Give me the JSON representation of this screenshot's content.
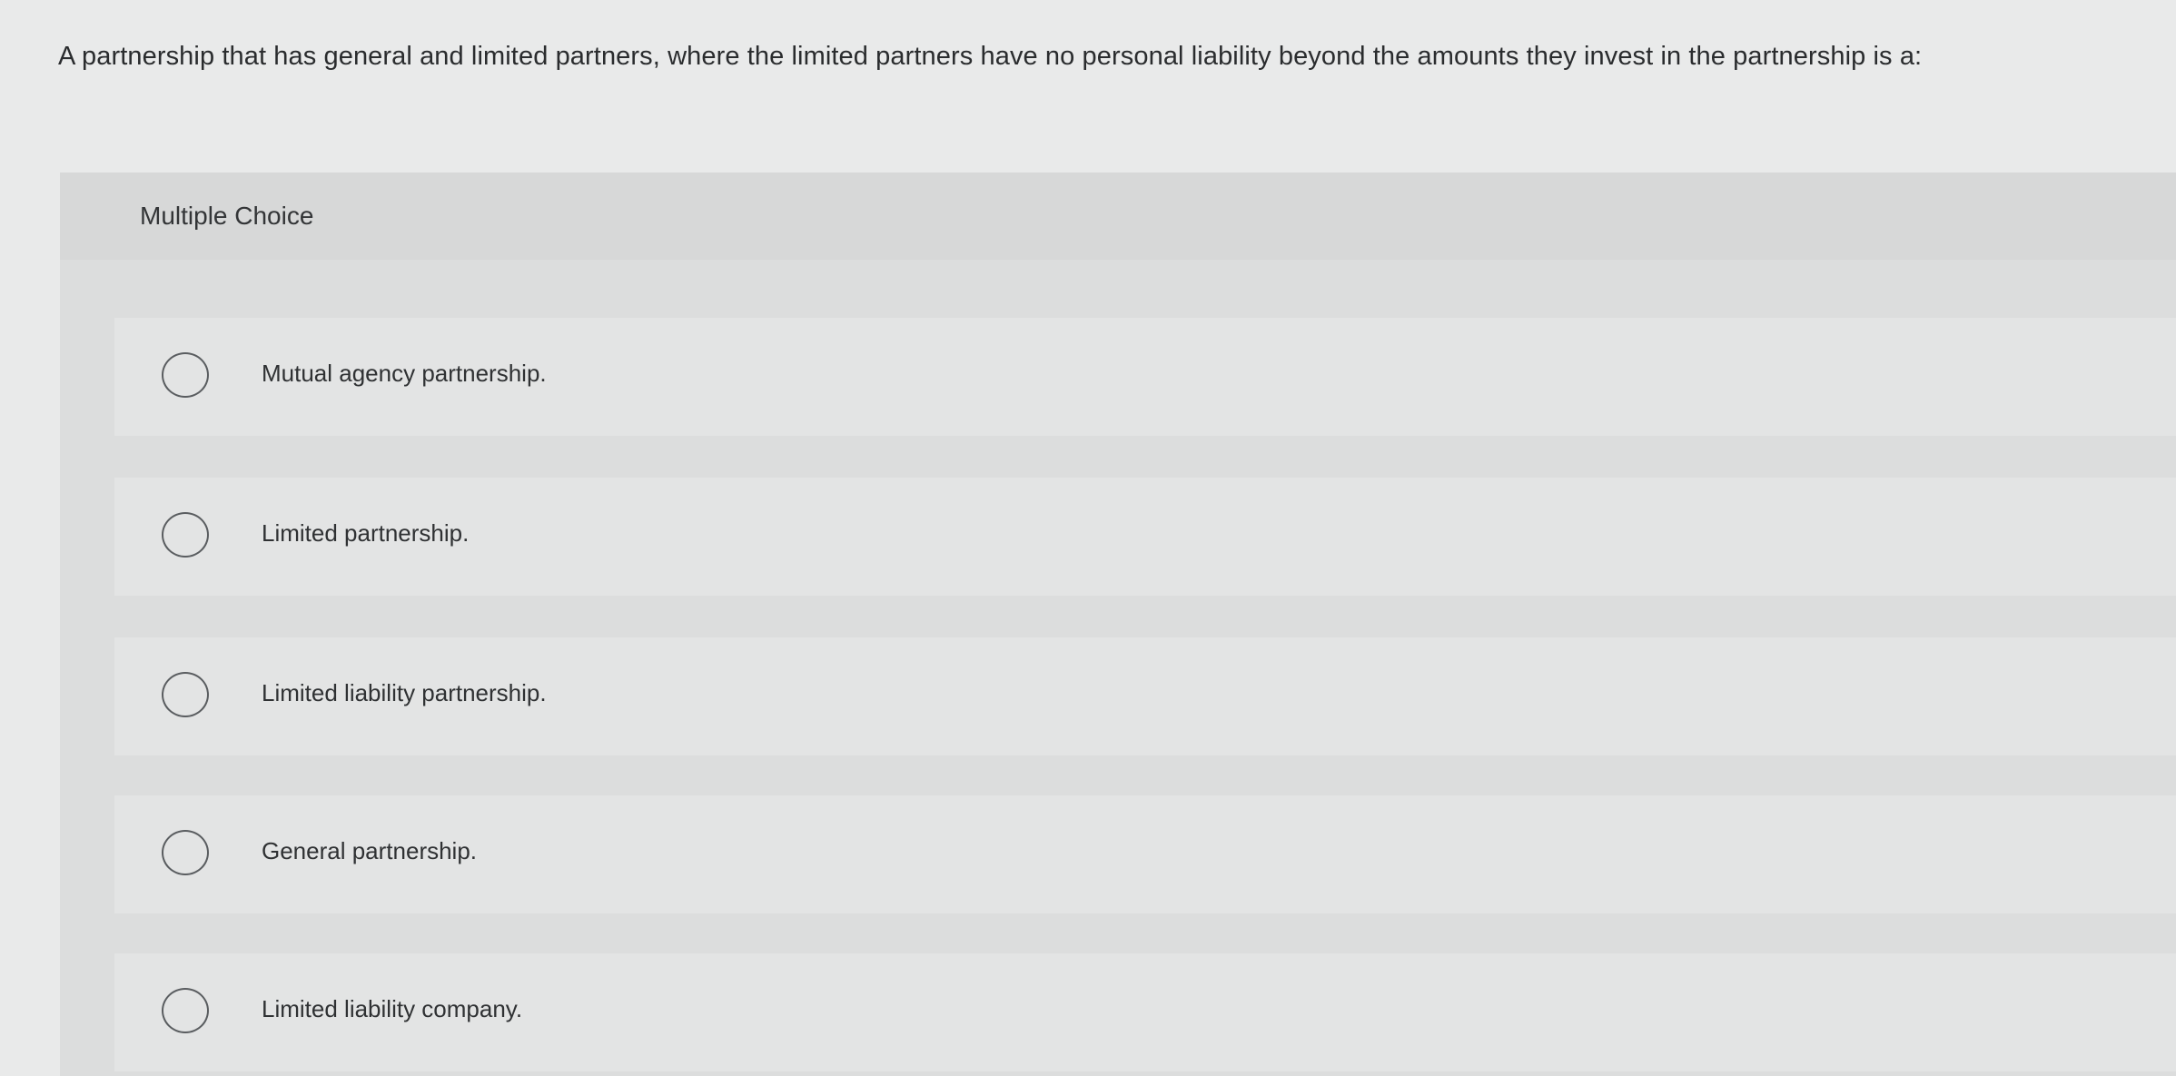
{
  "question": {
    "text": "A partnership that has general and limited partners, where the limited partners have no personal liability beyond the amounts they invest in the partnership is a:"
  },
  "panel": {
    "title": "Multiple Choice"
  },
  "options": [
    {
      "label": "Mutual agency partnership."
    },
    {
      "label": "Limited partnership."
    },
    {
      "label": "Limited liability partnership."
    },
    {
      "label": "General partnership."
    },
    {
      "label": "Limited liability company."
    }
  ],
  "colors": {
    "background": "#e9eaea",
    "panel": "#dcdddd",
    "option_row": "#e3e4e4",
    "radio_border": "#5a5d60"
  }
}
